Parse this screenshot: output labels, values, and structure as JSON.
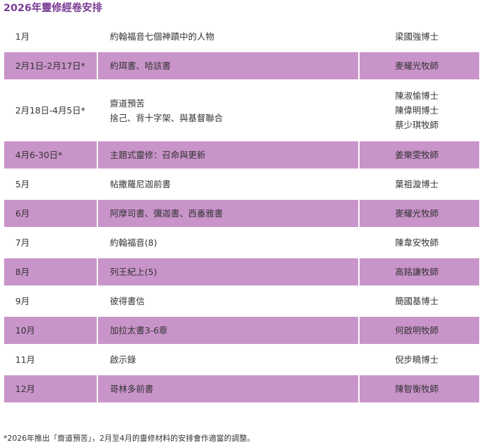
{
  "title": "2026年靈修經卷安排",
  "schedule": [
    {
      "period": "1月",
      "topic": [
        "約翰福音七個神蹟中的人物"
      ],
      "speakers": [
        "梁國強博士"
      ],
      "shaded": false
    },
    {
      "period": "2月1日-2月17日*",
      "topic": [
        "約珥書、哈該書"
      ],
      "speakers": [
        "麥耀光牧師"
      ],
      "shaded": true
    },
    {
      "period": "2月18日-4月5日*",
      "topic": [
        "齋道預苦",
        "捨己、背十字架、與基督聯合"
      ],
      "speakers": [
        "陳淑愉博士",
        "陳偉明博士",
        "蔡少琪牧師"
      ],
      "shaded": false
    },
    {
      "period": "4月6-30日*",
      "topic": [
        "主題式靈修：召命與更新"
      ],
      "speakers": [
        "姜樂雯牧師"
      ],
      "shaded": true
    },
    {
      "period": "5月",
      "topic": [
        "帖撒羅尼迦前書"
      ],
      "speakers": [
        "葉祖漩博士"
      ],
      "shaded": false
    },
    {
      "period": "6月",
      "topic": [
        "阿摩司書、彌迦書、西番雅書"
      ],
      "speakers": [
        "麥耀光牧師"
      ],
      "shaded": true
    },
    {
      "period": "7月",
      "topic": [
        "約翰福音(8)"
      ],
      "speakers": [
        "陳韋安牧師"
      ],
      "shaded": false
    },
    {
      "period": "8月",
      "topic": [
        "列王紀上(5)"
      ],
      "speakers": [
        "高銘謙牧師"
      ],
      "shaded": true
    },
    {
      "period": "9月",
      "topic": [
        "彼得書信"
      ],
      "speakers": [
        "簡國基博士"
      ],
      "shaded": false
    },
    {
      "period": "10月",
      "topic": [
        "加拉太書3-6章"
      ],
      "speakers": [
        "何啟明牧師"
      ],
      "shaded": true
    },
    {
      "period": "11月",
      "topic": [
        "啟示錄"
      ],
      "speakers": [
        "倪步曉博士"
      ],
      "shaded": false
    },
    {
      "period": "12月",
      "topic": [
        "哥林多前書"
      ],
      "speakers": [
        "陳智衡牧師"
      ],
      "shaded": true
    }
  ],
  "footnote": "*2026年推出「齋道預苦」，2月至4月的靈修材料的安排會作適當的調整。",
  "colors": {
    "title": "#7a3c94",
    "row_shade": "#c994c9",
    "text": "#333333"
  }
}
